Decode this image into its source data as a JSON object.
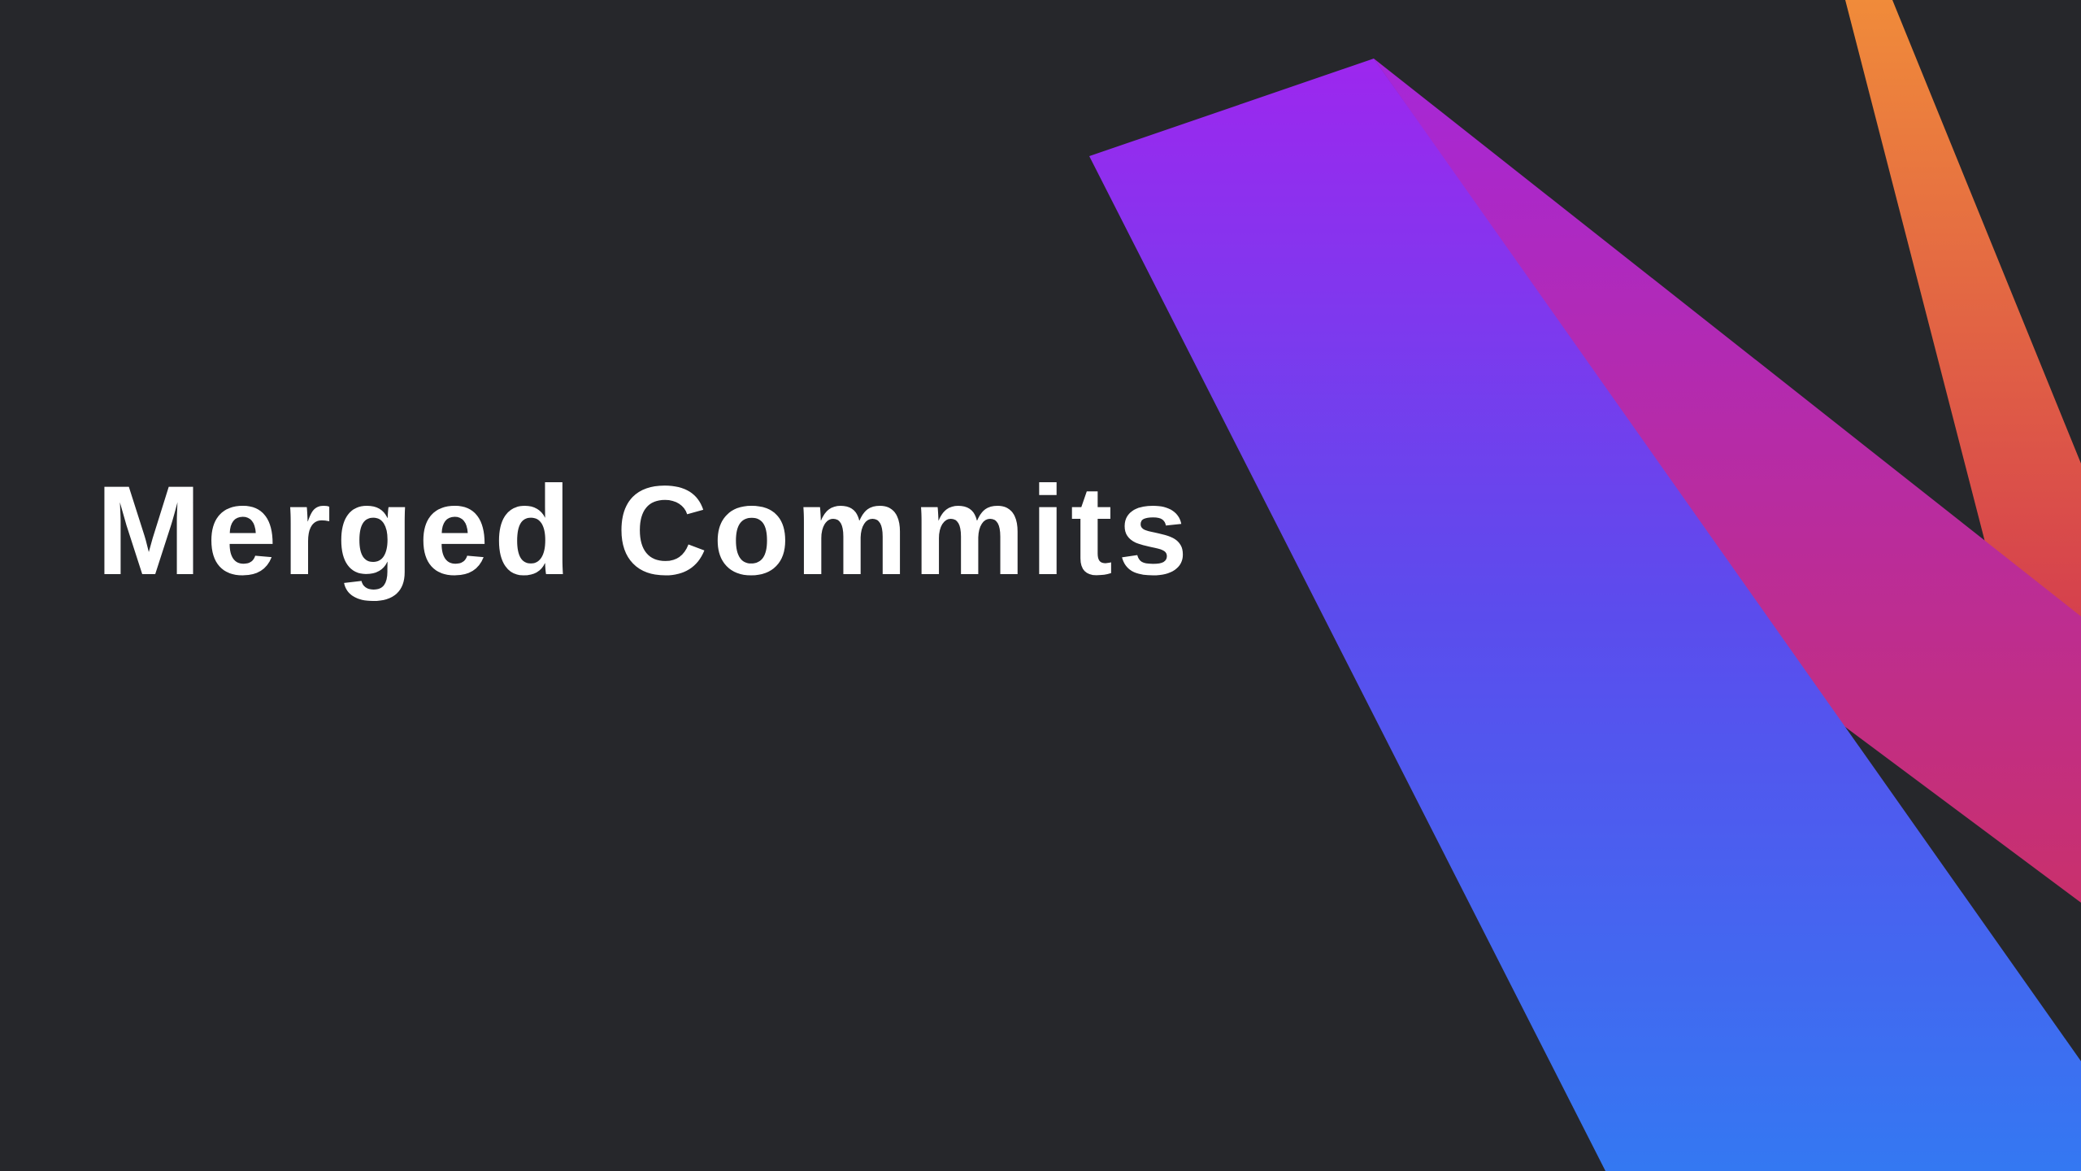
{
  "slide": {
    "title": "Merged Commits"
  },
  "decor": {
    "purple_blue_ribbon": {
      "from": "#9d27ee",
      "to": "#3478f2"
    },
    "magenta_ribbon": {
      "from": "#a627d8",
      "to": "#c9306c"
    },
    "orange_ribbon": {
      "from": "#f08b3a",
      "to": "#d5404d"
    },
    "background": "#26272b"
  }
}
